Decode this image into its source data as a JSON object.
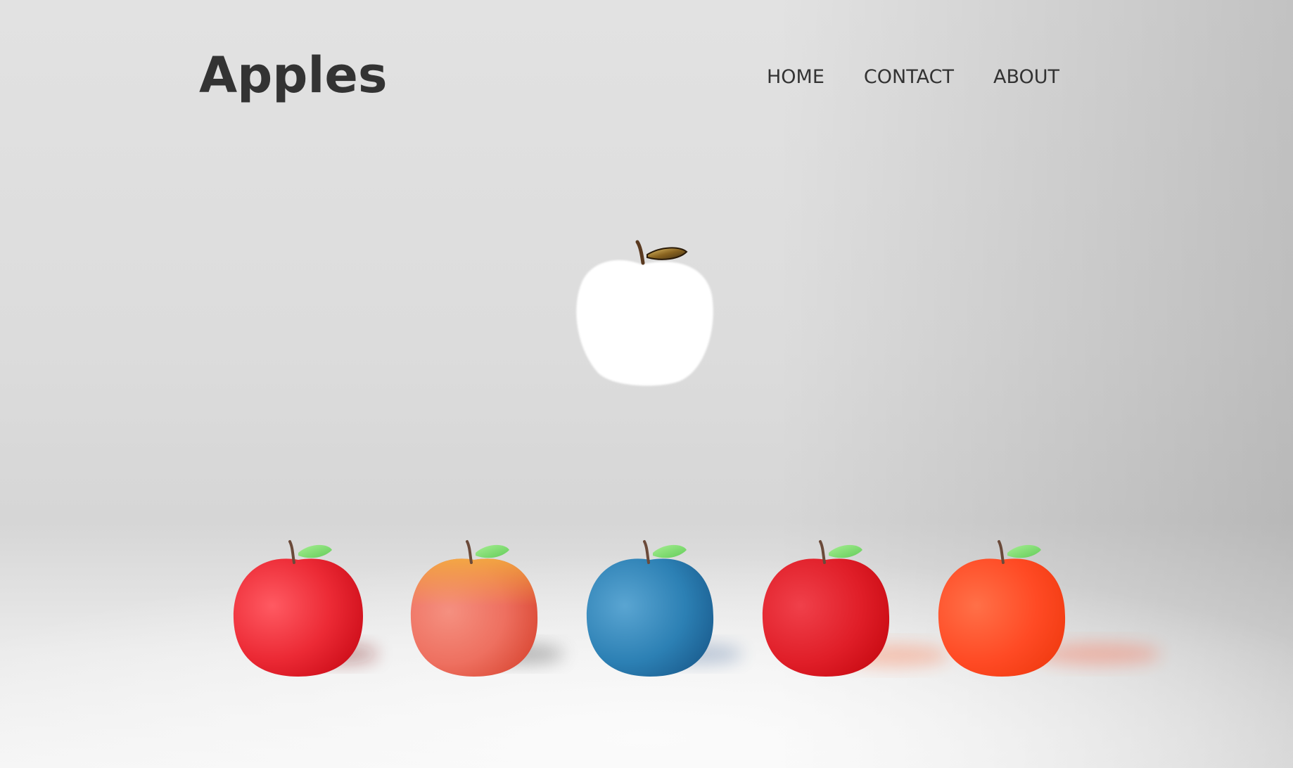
{
  "header": {
    "title": "Apples",
    "nav": [
      {
        "label": "HOME"
      },
      {
        "label": "CONTACT"
      },
      {
        "label": "ABOUT"
      }
    ]
  },
  "hero": {
    "featured_apple": {
      "name": "white-apple",
      "color": "#ffffff",
      "leaf_color": "#c9a24a"
    }
  },
  "apples": [
    {
      "name": "red-apple",
      "color": "#ec2a35",
      "highlight": "#ff5a60"
    },
    {
      "name": "peach-apple",
      "color": "#ee7060",
      "highlight": "#f7a070"
    },
    {
      "name": "blue-apple",
      "color": "#2c80b4",
      "highlight": "#4f9fce"
    },
    {
      "name": "crimson-apple",
      "color": "#e01e28",
      "highlight": "#f2424a"
    },
    {
      "name": "orange-apple",
      "color": "#ff4a24",
      "highlight": "#ff6a3e"
    }
  ],
  "theme": {
    "text": "#333333",
    "leaf": "#7fdc6e",
    "stem": "#6b4a3a"
  }
}
